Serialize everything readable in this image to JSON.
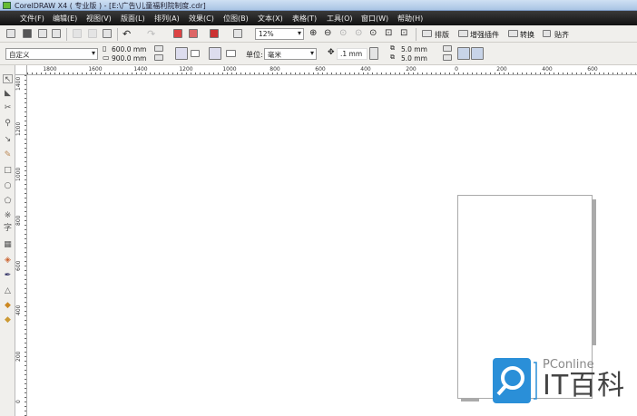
{
  "window": {
    "title": "CorelDRAW X4 ( 专业版 ) - [E:\\广告\\儿童福利院制度.cdr]"
  },
  "menu": [
    "文件(F)",
    "编辑(E)",
    "视图(V)",
    "版面(L)",
    "排列(A)",
    "效果(C)",
    "位图(B)",
    "文本(X)",
    "表格(T)",
    "工具(O)",
    "窗口(W)",
    "帮助(H)"
  ],
  "toolbar": {
    "zoom": "12%",
    "buttons": [
      "排版",
      "增强插件",
      "转换",
      "贴齐"
    ]
  },
  "propbar": {
    "paper_preset": "自定义",
    "width": "600.0 mm",
    "height": "900.0 mm",
    "units_label": "单位:",
    "units": "毫米",
    "nudge": ".1 mm",
    "dup_x": "5.0 mm",
    "dup_y": "5.0 mm"
  },
  "rulers": {
    "horizontal": [
      "1800",
      "1600",
      "1400",
      "1200",
      "1000",
      "800",
      "600",
      "400",
      "200",
      "0",
      "200",
      "400",
      "600"
    ],
    "vertical": [
      "1400",
      "1200",
      "1000",
      "800",
      "600",
      "400",
      "200",
      "0"
    ]
  },
  "watermark": {
    "brand": "PConline",
    "name": "IT百科",
    "color": "#2a8fd8"
  }
}
